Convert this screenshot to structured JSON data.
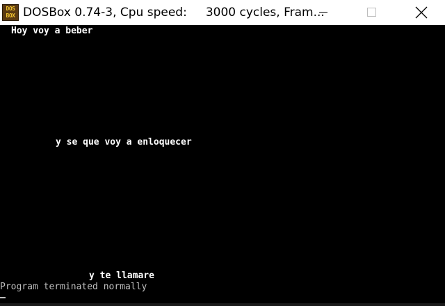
{
  "window": {
    "title": "DOSBox 0.74-3, Cpu speed:     3000 cycles, Fram...",
    "app_icon": "dosbox-icon",
    "icon_text": [
      "DOS",
      "BOX"
    ],
    "controls": [
      "minimize-icon",
      "maximize-icon",
      "close-icon"
    ]
  },
  "screen": {
    "lines": [
      "Hoy voy a beber",
      "y se que voy a enloquecer",
      "y te llamare"
    ],
    "status": "Program terminated normally",
    "cursor": "_"
  },
  "colors": {
    "screen_background": "#000000",
    "text": "#ffffff",
    "status_text": "#bfbfbf",
    "icon_background": "#5b3a12",
    "icon_text": "#f2c430"
  }
}
